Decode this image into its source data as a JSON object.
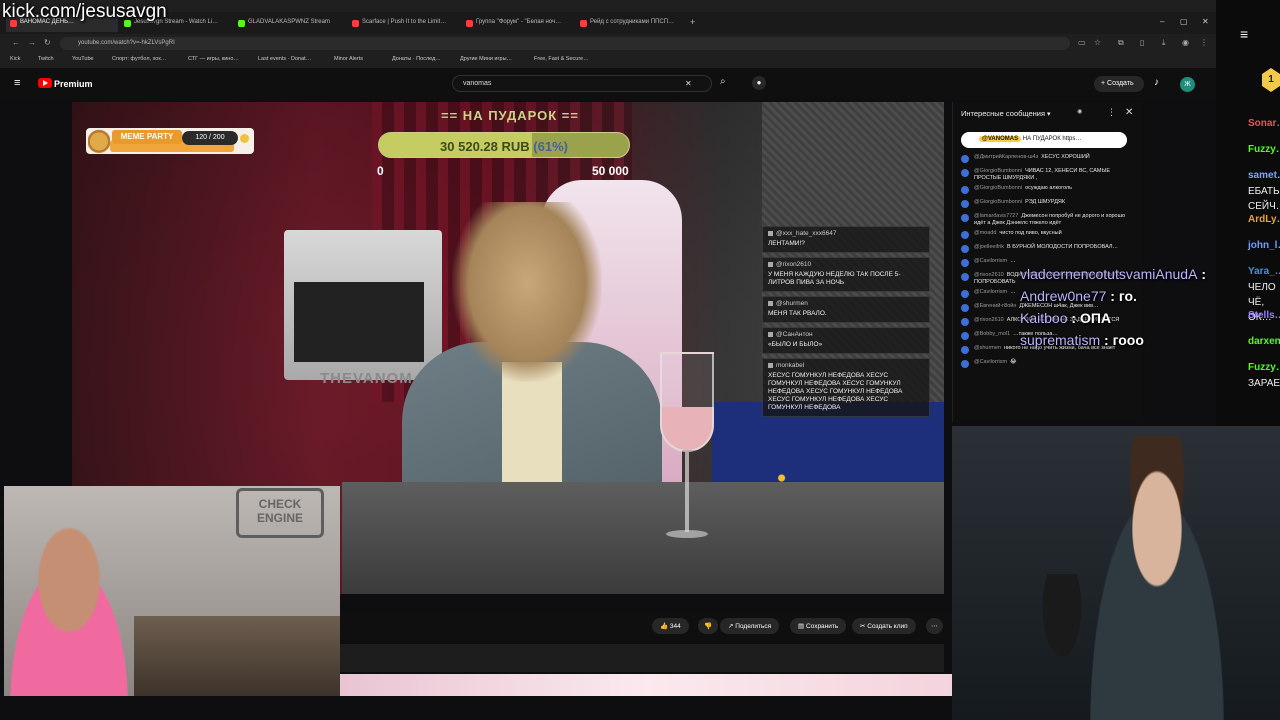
{
  "overlay": {
    "kick_url": "kick.com/jesusavgn"
  },
  "browser": {
    "tabs": [
      {
        "label": "ВАНОМАС ДЕНЬ…",
        "color": "#ff3b3b",
        "active": true
      },
      {
        "label": "Jesusavgn Stream - Watch Li…",
        "color": "#53fc18",
        "active": false
      },
      {
        "label": "GLADVALAKASPWNZ Stream",
        "color": "#53fc18",
        "active": false
      },
      {
        "label": "Scarface | Push It to the Limit…",
        "color": "#ff3b3b",
        "active": false
      },
      {
        "label": "Группа \"Форум\" - \"Белая ноч…",
        "color": "#ff3b3b",
        "active": false
      },
      {
        "label": "Рейд с сотрудниками ППСП…",
        "color": "#ff3b3b",
        "active": false
      }
    ],
    "new_tab": "+",
    "url": "youtube.com/watch?v=-hkZLVsPgRI",
    "bookmarks": [
      "Kick",
      "Twitch",
      "YouTube",
      "Спорт: футбол, хок…",
      "СТГ — игры, кино…",
      "Last events · Donat…",
      "Minor Alerts",
      "Донаты · Послед…",
      "Другие Мини игры…",
      "Free, Fast & Secure…"
    ],
    "window_controls": [
      "–",
      "▢",
      "✕"
    ]
  },
  "youtube": {
    "logo_label": "Premium",
    "search_value": "vanomas",
    "create_label": "Создать",
    "avatar_letter": "Ж",
    "actions": {
      "likes": "344",
      "share": "Поделиться",
      "save": "Сохранить",
      "clip": "Создать клип",
      "more": "⋯"
    }
  },
  "video": {
    "donation": {
      "title": "== НА ПУДАРОК ==",
      "amount": "30 520.28 RUB",
      "percent_label": "(61%)",
      "percent": 61,
      "min": "0",
      "max": "50 000"
    },
    "meme_party": {
      "label": "MEME PARTY",
      "count": "120 / 200"
    },
    "pc_text": "THEVANOM…",
    "overlay_chat": [
      {
        "user": "@xxx_hate_xxx6647",
        "text": "ЛЕНТАМИ!?"
      },
      {
        "user": "@rixon2610",
        "text": "У МЕНЯ КАЖДУЮ НЕДЕЛЮ ТАК ПОСЛЕ 5-ЛИТРОВ ПИВА ЗА НОЧЬ"
      },
      {
        "user": "@shurmen",
        "text": "МЕНЯ ТАК РВАЛО."
      },
      {
        "user": "@СанАнтон",
        "text": "«БЫЛО И БЫЛО»"
      },
      {
        "user": "monkabel",
        "text": "ХЕСУС ГОМУНКУЛ НЕФЕДОВА ХЕСУС ГОМУНКУЛ НЕФЕДОВА ХЕСУС ГОМУНКУЛ НЕФЕДОВА ХЕСУС ГОМУНКУЛ НЕФЕДОВА ХЕСУС ГОМУНКУЛ НЕФЕДОВА ХЕСУС ГОМУНКУЛ НЕФЕДОВА"
      }
    ]
  },
  "yt_chat": {
    "header": "Интересные сообщения",
    "close": "✕",
    "pinned_user": "@VANOMAS",
    "pinned_text": "НА ПУДАРОК https…",
    "messages": [
      {
        "user": "@ДмитрийКарпенов-ш4з",
        "text": "ХЕСУС ХОРОШИЙ"
      },
      {
        "user": "@GiorgioBumbonni",
        "text": "ЧИВАС 12, ХЕНЕСИ ВС, САМЫЕ ПРОСТЫЕ ШМУРДЯКИ ,"
      },
      {
        "user": "@GiorgioBumbonni",
        "text": "осуждаю алкоголь"
      },
      {
        "user": "@GiorgioBumbonni",
        "text": "РЭД ШМУРДЯК"
      },
      {
        "user": "@lamardavis7727",
        "text": "Джемесон попробуй не дорого и хорошо идёт а Джек Дэниелс тяжело идёт"
      },
      {
        "user": "@moadd",
        "text": "чисто под пиво, вкусный"
      },
      {
        "user": "@joelleeifrik",
        "text": "В БУРНОЙ МОЛОДОСТИ ПОПРОБОВАЛ…"
      },
      {
        "user": "@Cavilorrism",
        "text": "…"
      },
      {
        "user": "@rixon2610",
        "text": "ВОДКУ SPELTA ЗА 3К РУБЛЕЙ НАДО БЫЛО ПОПРОБОВАТЬ"
      },
      {
        "user": "@Cavilorrism",
        "text": "…"
      },
      {
        "user": "@Евгений-г8ойн",
        "text": "ДЖЕМЕСОН ш4ак, Джек вив…"
      },
      {
        "user": "@rixon2610",
        "text": "АЛКОГОЛИ НЕТ. ОН НЕ ЗАДЕРЖИВАЕТСЯ"
      },
      {
        "user": "@Bobby_mol1",
        "text": "…также польза…"
      },
      {
        "user": "@shurmen",
        "text": "никого не надо учить жизни, бача все знает"
      },
      {
        "user": "@Cavilorrism",
        "text": "😂"
      }
    ]
  },
  "kick_chat": [
    {
      "user": "vladcernencotutsvamiAnudA",
      "text": ""
    },
    {
      "user": "Andrew0ne77",
      "text": "го."
    },
    {
      "user": "Kaitboo",
      "text": "ОПА"
    },
    {
      "user": "suprematism",
      "text": "гооо"
    }
  ],
  "kick_sidebar": {
    "menu_icon": "≡",
    "badge": "1",
    "items": [
      {
        "name": "Sonar…",
        "color": "#e05a5a",
        "text": ""
      },
      {
        "name": "Fuzzy…",
        "color": "#53fc18",
        "text": ""
      },
      {
        "name": "samet…",
        "color": "#7aa8ff",
        "text": "ЕБАТЬ СЕЙЧ…"
      },
      {
        "name": "ArdLy…",
        "color": "#f0a030",
        "text": ""
      },
      {
        "name": "john_l…",
        "color": "#6aa0ff",
        "text": ""
      },
      {
        "name": "Yara_…",
        "color": "#4a90e2",
        "text": "ЧЕЛО ЧЁ, ОК…"
      },
      {
        "name": "Stells…",
        "color": "#9a7bff",
        "text": ""
      },
      {
        "name": "darxen…",
        "color": "#53fc18",
        "text": ""
      },
      {
        "name": "Fuzzy…",
        "color": "#53fc18",
        "text": "ЗАРАЕ…"
      }
    ]
  },
  "cams": {
    "left_sign": "CHECK ENGINE"
  }
}
